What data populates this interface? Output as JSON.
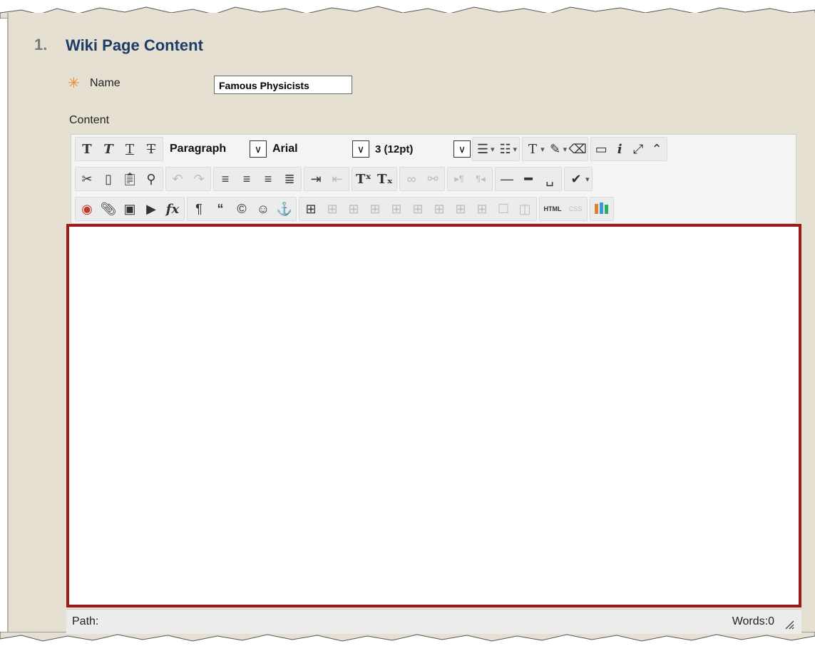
{
  "section": {
    "number": "1.",
    "title": "Wiki Page Content"
  },
  "name_field": {
    "required_icon": "asterisk-icon",
    "label": "Name",
    "value": "Famous Physicists"
  },
  "content_label": "Content",
  "toolbar": {
    "paragraph_select": "Paragraph",
    "font_select": "Arial",
    "size_select": "3 (12pt)",
    "html_label": "HTML",
    "css_label": "CSS"
  },
  "status": {
    "path_label": "Path:",
    "words_label": "Words:0"
  },
  "colors": {
    "panel_bg": "#e6e0d2",
    "title": "#1d3c66",
    "editor_border": "#9b1b1b",
    "required": "#e8892a"
  }
}
